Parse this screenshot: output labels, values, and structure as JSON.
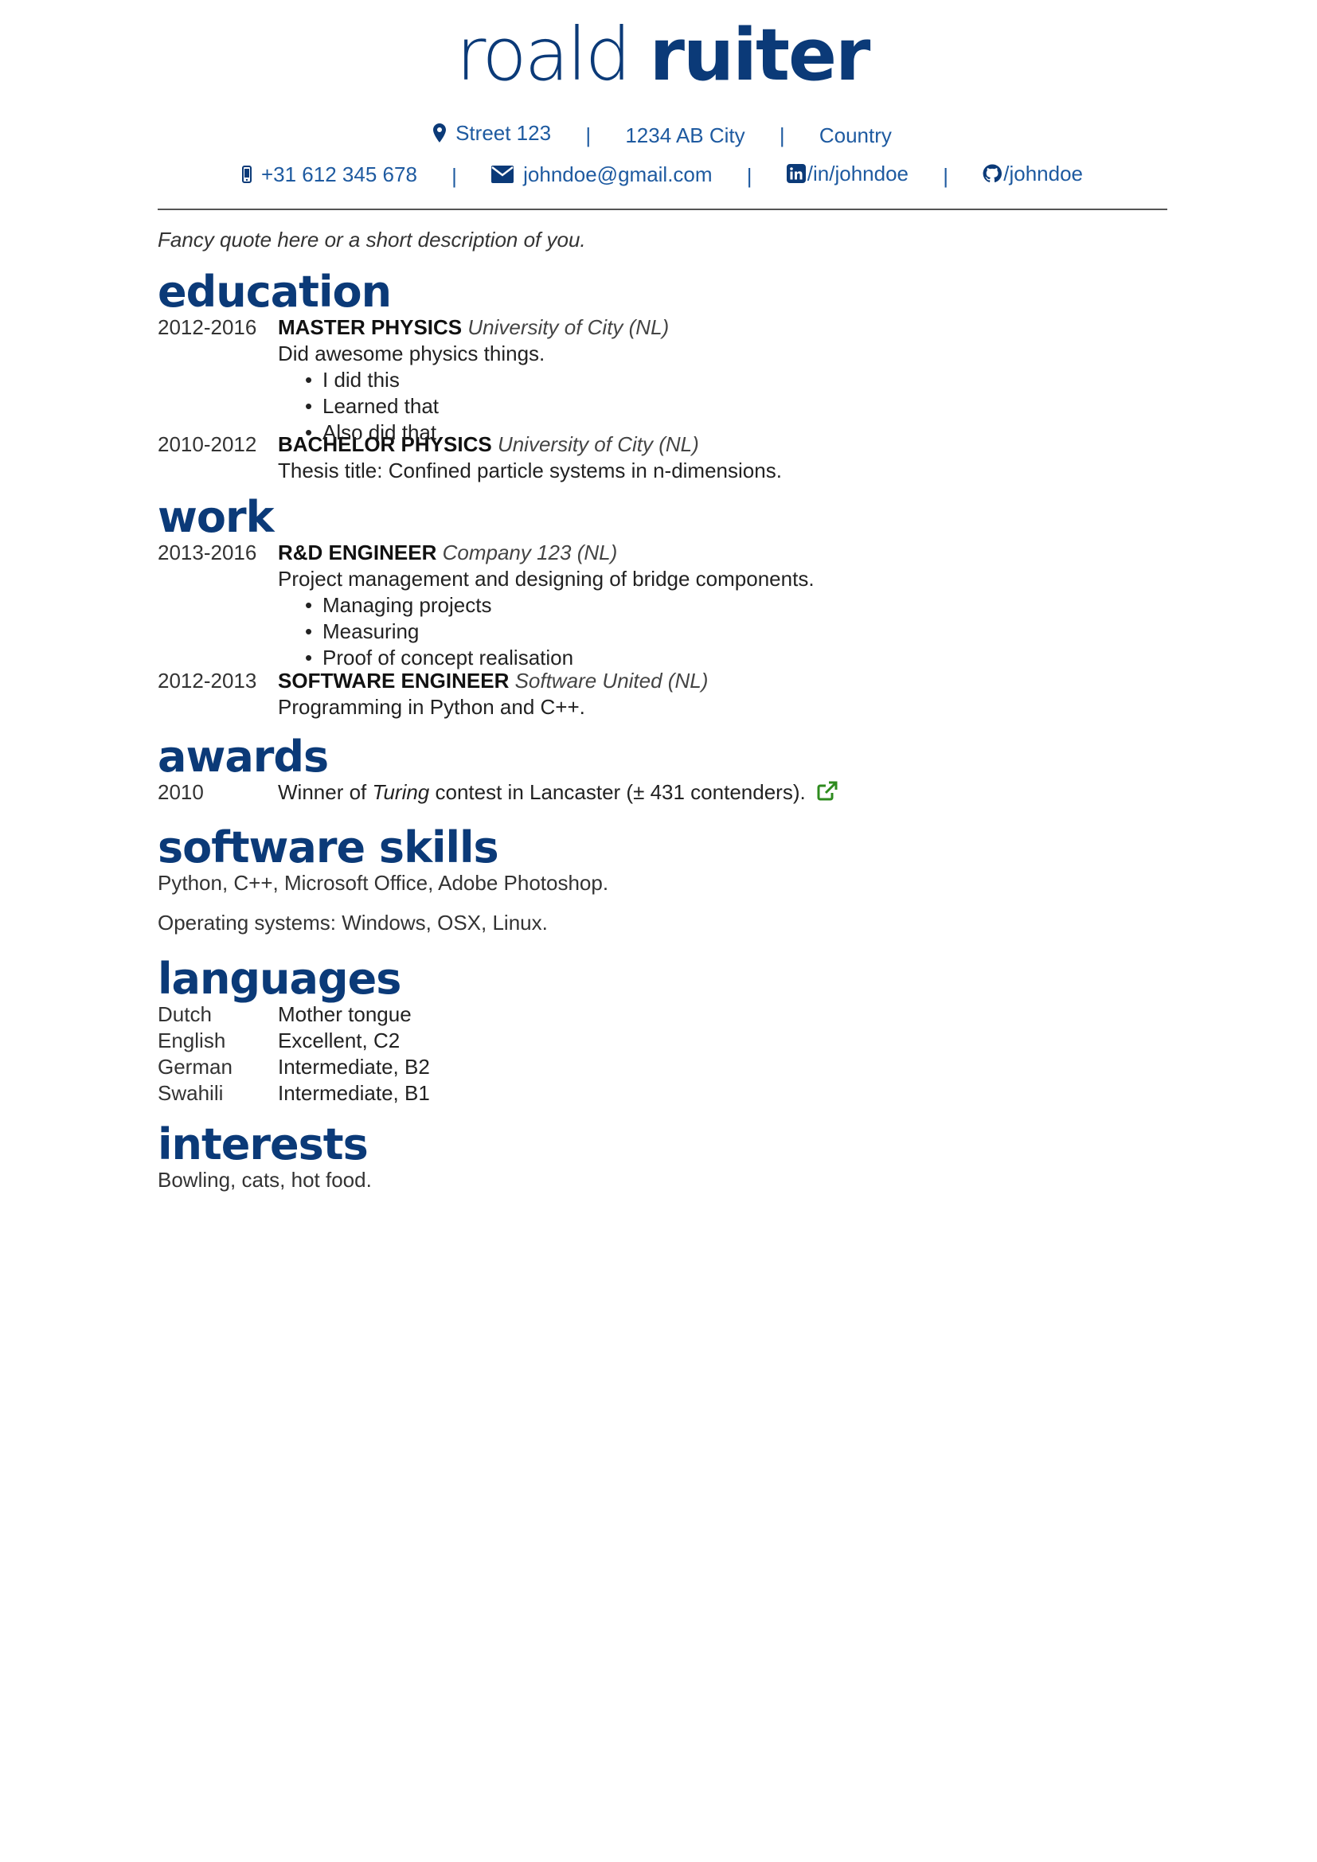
{
  "header": {
    "first_name": "roald",
    "last_name": "ruiter",
    "address": {
      "street": "Street 123",
      "city": "1234 AB City",
      "country": "Country"
    },
    "contact": {
      "phone": "+31 612 345 678",
      "email": "johndoe@gmail.com",
      "linkedin": "/in/johndoe",
      "github": "/johndoe"
    },
    "separator": "|",
    "quote": "Fancy quote here or a short description of you."
  },
  "education": {
    "title": "education",
    "entries": [
      {
        "date": "2012-2016",
        "role": "MASTER PHYSICS",
        "org": "University of City (NL)",
        "description": "Did awesome physics things.",
        "bullets": [
          "I did this",
          "Learned that",
          "Also did that"
        ]
      },
      {
        "date": "2010-2012",
        "role": "BACHELOR PHYSICS",
        "org": "University of City (NL)",
        "description": "Thesis title:  Confined particle systems in n-dimensions."
      }
    ]
  },
  "work": {
    "title": "work",
    "entries": [
      {
        "date": "2013-2016",
        "role": "R&D ENGINEER",
        "org": "Company 123 (NL)",
        "description": "Project management and designing of bridge components.",
        "bullets": [
          "Managing projects",
          "Measuring",
          "Proof of concept realisation"
        ]
      },
      {
        "date": "2012-2013",
        "role": "SOFTWARE ENGINEER",
        "org": "Software United (NL)",
        "description": "Programming in Python and C++."
      }
    ]
  },
  "awards": {
    "title": "awards",
    "entries": [
      {
        "date": "2010",
        "text_before": "Winner of ",
        "text_italic": "Turing",
        "text_after": " contest in Lancaster (± 431 contenders)."
      }
    ]
  },
  "software_skills": {
    "title": "software skills",
    "line1": "Python, C++, Microsoft Office, Adobe Photoshop.",
    "line2": "Operating systems: Windows, OSX, Linux."
  },
  "languages": {
    "title": "languages",
    "items": [
      {
        "language": "Dutch",
        "level": "Mother tongue"
      },
      {
        "language": "English",
        "level": "Excellent, C2"
      },
      {
        "language": "German",
        "level": "Intermediate, B2"
      },
      {
        "language": "Swahili",
        "level": "Intermediate, B1"
      }
    ]
  },
  "interests": {
    "title": "interests",
    "text": "Bowling, cats, hot food."
  },
  "colors": {
    "accent": "#0b3a78",
    "link": "#1e5aa0",
    "award_icon": "#2e8b1e"
  },
  "icons": [
    "map-marker-icon",
    "mobile-phone-icon",
    "envelope-icon",
    "linkedin-icon",
    "github-icon",
    "external-link-icon"
  ]
}
